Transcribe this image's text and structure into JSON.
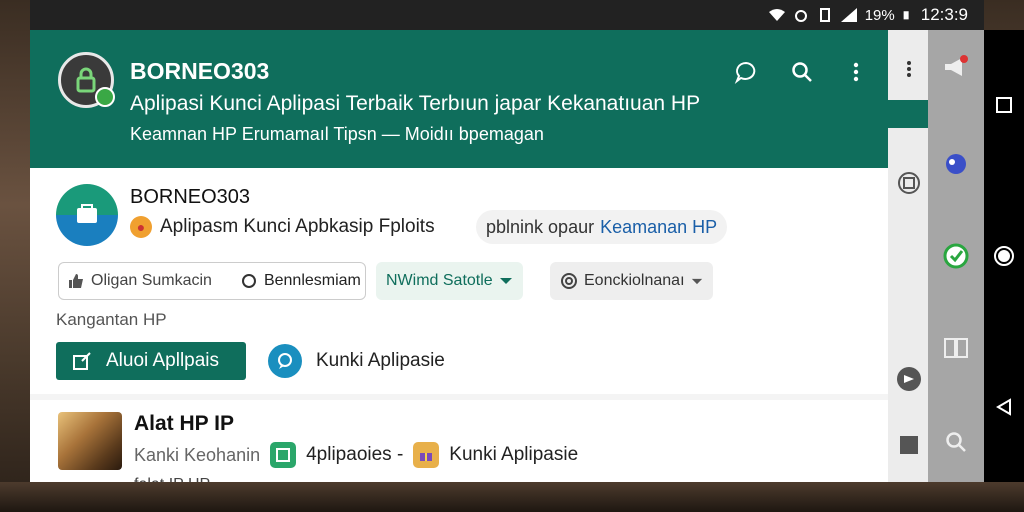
{
  "status_bar": {
    "battery": "19%",
    "time": "12:3:9"
  },
  "header": {
    "title": "BORNEO303",
    "subtitle": "Aplipasi Kunci Aplipasi Terbaik Terbıun japar Kekanatıuan HP",
    "tagline": "Keamnan HP Erumamaıl Tipsn — Moidıı bpemagan"
  },
  "post": {
    "author": "BORNEO303",
    "text": "Aplipasm Kunci Apbkasip Fploits",
    "tag_text": "pblnink opaur",
    "tag_link": "Keamanan HP",
    "chip_group": {
      "left_label": "Oligan Sumkacin",
      "right_label": "Bennlesmiam"
    },
    "chip_wind": "NWimd Satotle",
    "chip_settings": "Eonckiolnanaı",
    "section_label": "Kangantan HP",
    "primary_button": "Aluoi Apllpais",
    "secondary_label": "Kunki Aplipasie"
  },
  "item": {
    "title": "Alat HP IP",
    "meta_muted": "Kanki Keohanin",
    "meta_mid": "4plipaoies -",
    "meta_end": "Kunki Aplipasie",
    "cut_text": "falat IP HP"
  },
  "colors": {
    "primary": "#0f6e5c",
    "link": "#1a5fa8",
    "accent_blue": "#1a8fbf"
  },
  "icons": {
    "header": [
      "chat-icon",
      "search-icon",
      "more-vert-icon"
    ],
    "side": [
      "more-vert-icon",
      "gallery-icon",
      "play-icon",
      "square-icon"
    ],
    "rail": [
      "megaphone-icon",
      "gamepad-icon",
      "check-icon",
      "book-icon",
      "search-icon"
    ],
    "nav": [
      "recents-icon",
      "home-icon",
      "back-icon"
    ]
  }
}
